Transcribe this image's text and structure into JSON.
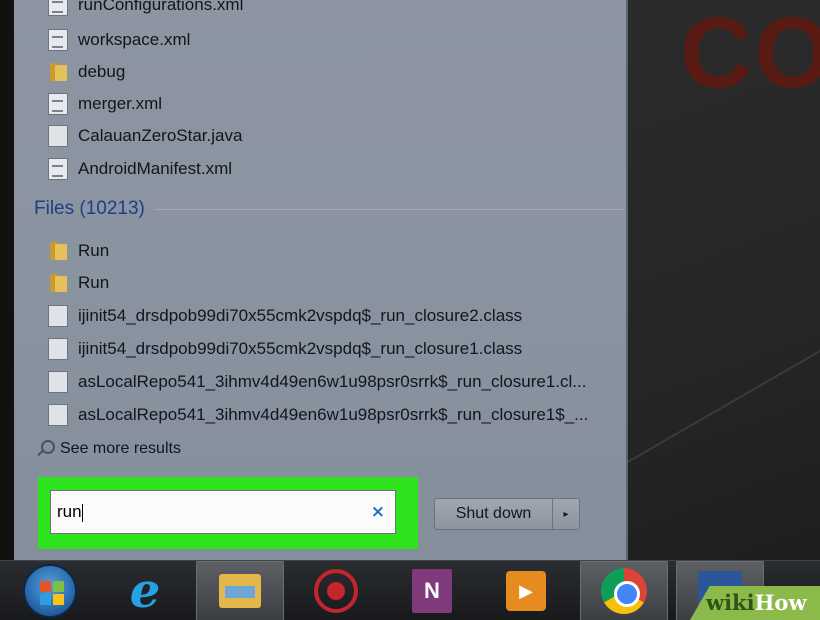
{
  "recent_items": [
    {
      "label": "runConfigurations.xml",
      "icon": "xml-document-icon"
    },
    {
      "label": "workspace.xml",
      "icon": "xml-document-icon"
    },
    {
      "label": "debug",
      "icon": "folder-icon"
    },
    {
      "label": "merger.xml",
      "icon": "xml-document-icon"
    },
    {
      "label": "CalauanZeroStar.java",
      "icon": "file-icon"
    },
    {
      "label": "AndroidManifest.xml",
      "icon": "xml-document-icon"
    }
  ],
  "files_section": {
    "header": "Files (10213)",
    "items": [
      {
        "label": "Run",
        "icon": "folder-icon"
      },
      {
        "label": "Run",
        "icon": "folder-icon"
      },
      {
        "label": "ijinit54_drsdpob99di70x55cmk2vspdq$_run_closure2.class",
        "icon": "file-icon"
      },
      {
        "label": "ijinit54_drsdpob99di70x55cmk2vspdq$_run_closure1.class",
        "icon": "file-icon"
      },
      {
        "label": "asLocalRepo541_3ihmv4d49en6w1u98psr0srrk$_run_closure1.cl...",
        "icon": "file-icon"
      },
      {
        "label": "asLocalRepo541_3ihmv4d49en6w1u98psr0srrk$_run_closure1$_...",
        "icon": "file-icon"
      }
    ]
  },
  "see_more": "See more results",
  "search": {
    "value": "run",
    "clear_glyph": "×"
  },
  "shutdown": {
    "label": "Shut down",
    "arrow": "▸"
  },
  "desktop_text": "CO",
  "taskbar": {
    "items": [
      "start-orb",
      "internet-explorer-icon",
      "file-explorer-icon",
      "app-ring-icon",
      "onenote-icon",
      "media-player-icon",
      "chrome-icon",
      "word-icon"
    ],
    "onenote_glyph": "N",
    "media_glyph": "▶"
  },
  "watermark": {
    "part1": "wiki",
    "part2": "How"
  },
  "colors": {
    "highlight": "#2ee21e",
    "section_header": "#1d3f86",
    "menu_bg": "#8d95a2"
  }
}
